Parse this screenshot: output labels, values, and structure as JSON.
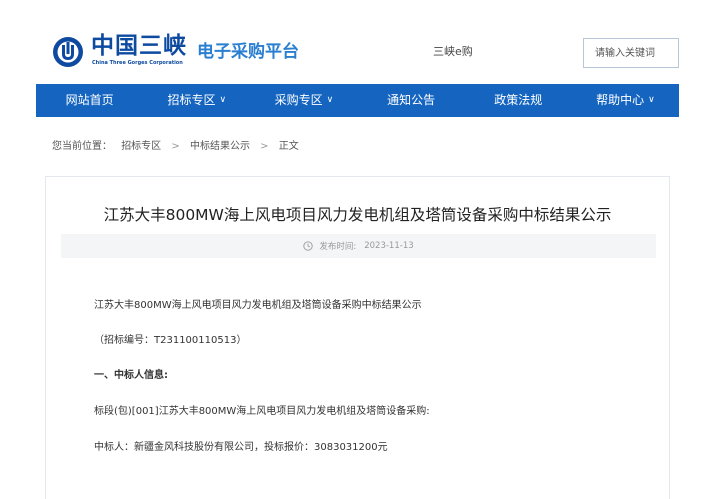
{
  "header": {
    "logo_cn": "中国三峡",
    "logo_en": "China Three Gorges Corporation",
    "platform_title": "电子采购平台",
    "egou_link": "三峡e购",
    "search_placeholder": "请输入关键词"
  },
  "nav": {
    "items": [
      {
        "label": "网站首页",
        "has_dropdown": false
      },
      {
        "label": "招标专区",
        "has_dropdown": true
      },
      {
        "label": "采购专区",
        "has_dropdown": true
      },
      {
        "label": "通知公告",
        "has_dropdown": false
      },
      {
        "label": "政策法规",
        "has_dropdown": false
      },
      {
        "label": "帮助中心",
        "has_dropdown": true
      }
    ],
    "chevron": "∨"
  },
  "breadcrumb": {
    "prefix": "您当前位置：",
    "items": [
      "招标专区",
      "中标结果公示",
      "正文"
    ],
    "separator": ">"
  },
  "article": {
    "title": "江苏大丰800MW海上风电项目风力发电机组及塔筒设备采购中标结果公示",
    "publish_label": "发布时间:",
    "publish_date": "2023-11-13",
    "paragraphs": [
      {
        "text": "江苏大丰800MW海上风电项目风力发电机组及塔筒设备采购中标结果公示",
        "bold": false
      },
      {
        "text": "（招标编号：T231100110513）",
        "bold": false
      },
      {
        "text": "一、中标人信息:",
        "bold": true
      },
      {
        "text": "标段(包)[001]江苏大丰800MW海上风电项目风力发电机组及塔筒设备采购:",
        "bold": false
      },
      {
        "text": "中标人：新疆金风科技股份有限公司，投标报价：3083031200元",
        "bold": false
      }
    ]
  },
  "colors": {
    "nav_bg": "#1565c0",
    "logo_blue": "#0d4aa0",
    "platform_blue": "#2a7fd0"
  }
}
